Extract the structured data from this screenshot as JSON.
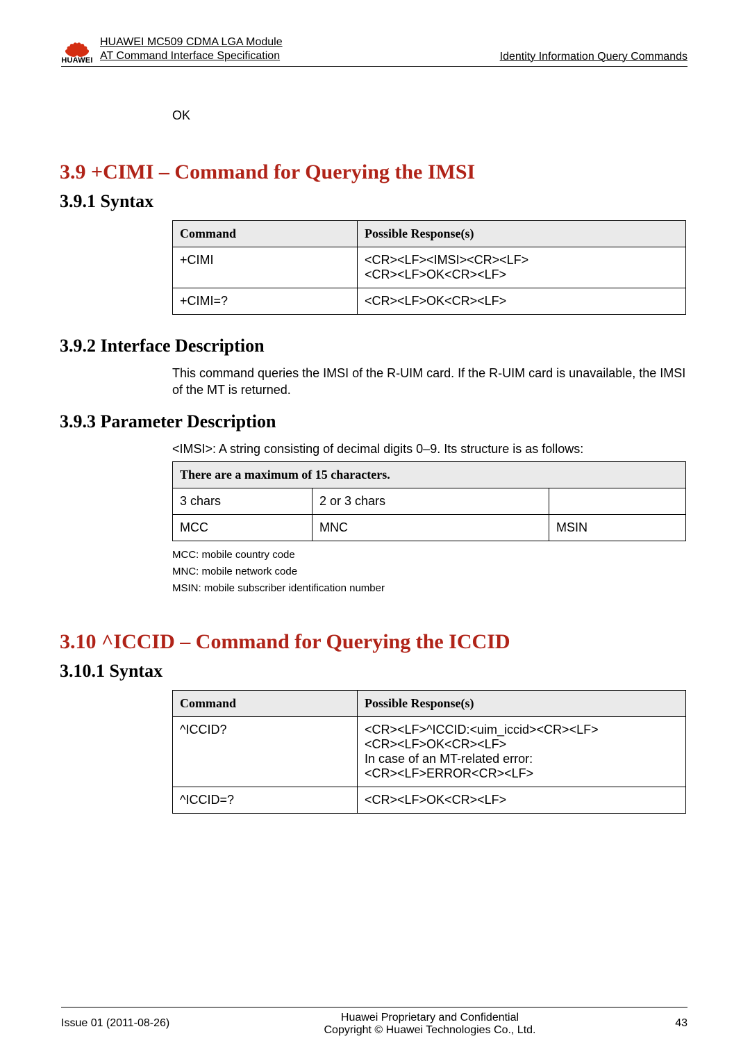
{
  "header": {
    "logo_text": "HUAWEI",
    "title1": "HUAWEI MC509 CDMA LGA Module",
    "title2": "AT Command Interface Specification",
    "right": "Identity Information Query Commands"
  },
  "ok_line": "OK",
  "section39": {
    "heading": "3.9 +CIMI – Command for Querying the IMSI",
    "syntax_heading": "3.9.1 Syntax",
    "table": {
      "h1": "Command",
      "h2": "Possible Response(s)",
      "r1c1": "+CIMI",
      "r1c2a": "<CR><LF><IMSI><CR><LF>",
      "r1c2b": "<CR><LF>OK<CR><LF>",
      "r2c1": "+CIMI=?",
      "r2c2": "<CR><LF>OK<CR><LF>"
    },
    "ifdesc_heading": "3.9.2 Interface Description",
    "ifdesc_text": "This command queries the IMSI of the R-UIM card. If the R-UIM card is unavailable, the IMSI of the MT is returned.",
    "pardesc_heading": "3.9.3 Parameter Description",
    "pardesc_text": "<IMSI>: A string consisting of decimal digits 0–9. Its structure is as follows:",
    "imsi_table": {
      "header": "There are a maximum of 15 characters.",
      "r1c1": "3 chars",
      "r1c2": "2 or 3 chars",
      "r1c3": "",
      "r2c1": "MCC",
      "r2c2": "MNC",
      "r2c3": "MSIN"
    },
    "notes": {
      "n1": "MCC: mobile country code",
      "n2": "MNC: mobile network code",
      "n3": "MSIN: mobile subscriber identification number"
    }
  },
  "section310": {
    "heading": "3.10 ^ICCID – Command for Querying the ICCID",
    "syntax_heading": "3.10.1 Syntax",
    "table": {
      "h1": "Command",
      "h2": "Possible Response(s)",
      "r1c1": "^ICCID?",
      "r1c2a": "<CR><LF>^ICCID:<uim_iccid><CR><LF>",
      "r1c2b": "<CR><LF>OK<CR><LF>",
      "r1c2c": "In case of an MT-related error:",
      "r1c2d": "<CR><LF>ERROR<CR><LF>",
      "r2c1": "^ICCID=?",
      "r2c2": "<CR><LF>OK<CR><LF>"
    }
  },
  "footer": {
    "left": "Issue 01 (2011-08-26)",
    "center1": "Huawei Proprietary and Confidential",
    "center2": "Copyright © Huawei Technologies Co., Ltd.",
    "right": "43"
  }
}
